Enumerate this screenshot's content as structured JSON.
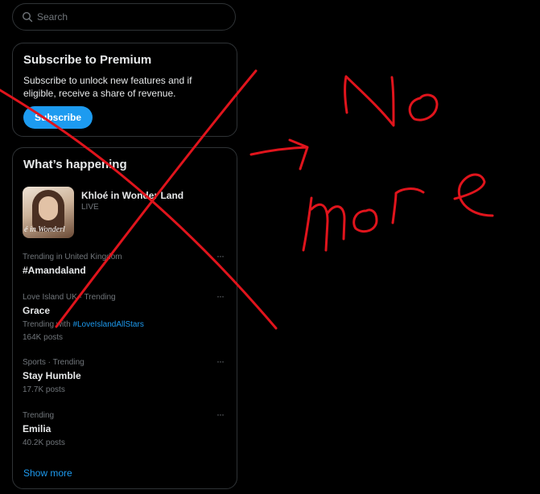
{
  "search": {
    "placeholder": "Search"
  },
  "premium": {
    "title": "Subscribe to Premium",
    "body": "Subscribe to unlock new features and if eligible, receive a share of revenue.",
    "button": "Subscribe"
  },
  "happening": {
    "title": "What’s happening",
    "live": {
      "title": "Khloé in Wonder Land",
      "status": "LIVE",
      "thumb_text": "é in Wonderl"
    },
    "trends": [
      {
        "meta": "Trending in United Kingdom",
        "name": "#Amandaland"
      },
      {
        "meta": "Love Island UK · Trending",
        "name": "Grace",
        "sub_prefix": "Trending with ",
        "sub_tag": "#LoveIslandAllStars",
        "count": "164K posts"
      },
      {
        "meta": "Sports · Trending",
        "name": "Stay Humble",
        "count": "17.7K posts"
      },
      {
        "meta": "Trending",
        "name": "Emilia",
        "count": "40.2K posts"
      }
    ],
    "show_more": "Show more"
  },
  "annotation": {
    "text_line1": "No",
    "text_line2": "more",
    "color": "#e0141c"
  },
  "colors": {
    "accent": "#1d9bf0",
    "background": "#000000",
    "border": "#2f3336",
    "muted": "#71767b"
  }
}
